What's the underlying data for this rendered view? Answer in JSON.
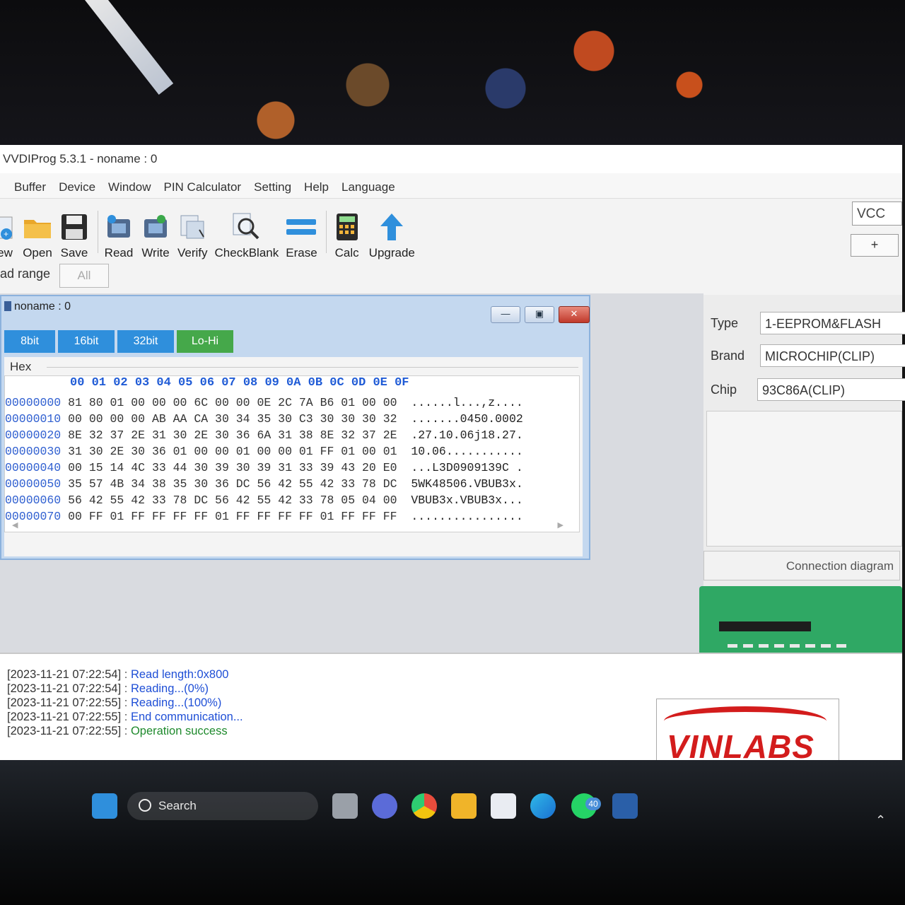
{
  "window": {
    "title": "VVDIProg 5.3.1 - noname : 0"
  },
  "menu": [
    "Buffer",
    "Device",
    "Window",
    "PIN Calculator",
    "Setting",
    "Help",
    "Language"
  ],
  "toolbar": {
    "new": "ew",
    "open": "Open",
    "save": "Save",
    "read": "Read",
    "write": "Write",
    "verify": "Verify",
    "checkblank": "CheckBlank",
    "erase": "Erase",
    "calc": "Calc",
    "upgrade": "Upgrade"
  },
  "vcc": {
    "label": "VCC",
    "plus": "+"
  },
  "range": {
    "label": "ad range",
    "value": "All"
  },
  "buffer_window": {
    "title": "noname : 0",
    "modes": [
      "8bit",
      "16bit",
      "32bit",
      "Lo-Hi"
    ],
    "hex_label": "Hex",
    "header": "00 01 02 03 04 05 06 07 08 09 0A 0B 0C 0D 0E 0F",
    "rows": [
      {
        "addr": "00000000",
        "bytes": "81 80 01 00 00 00 6C 00 00 0E 2C 7A B6 01 00 00",
        "ascii": "......l...,z...."
      },
      {
        "addr": "00000010",
        "bytes": "00 00 00 00 AB AA CA 30 34 35 30 C3 30 30 30 32",
        "ascii": ".......0450.0002"
      },
      {
        "addr": "00000020",
        "bytes": "8E 32 37 2E 31 30 2E 30 36 6A 31 38 8E 32 37 2E",
        "ascii": ".27.10.06j18.27."
      },
      {
        "addr": "00000030",
        "bytes": "31 30 2E 30 36 01 00 00 01 00 00 01 FF 01 00 01",
        "ascii": "10.06..........."
      },
      {
        "addr": "00000040",
        "bytes": "00 15 14 4C 33 44 30 39 30 39 31 33 39 43 20 E0",
        "ascii": "...L3D0909139C ."
      },
      {
        "addr": "00000050",
        "bytes": "35 57 4B 34 38 35 30 36 DC 56 42 55 42 33 78 DC",
        "ascii": "5WK48506.VBUB3x."
      },
      {
        "addr": "00000060",
        "bytes": "56 42 55 42 33 78 DC 56 42 55 42 33 78 05 04 00",
        "ascii": "VBUB3x.VBUB3x..."
      },
      {
        "addr": "00000070",
        "bytes": "00 FF 01 FF FF FF FF 01 FF FF FF FF 01 FF FF FF",
        "ascii": "................"
      }
    ]
  },
  "properties": {
    "type_label": "Type",
    "type_value": "1-EEPROM&FLASH",
    "brand_label": "Brand",
    "brand_value": "MICROCHIP(CLIP)",
    "chip_label": "Chip",
    "chip_value": "93C86A(CLIP)",
    "connection_button": "Connection diagram"
  },
  "log": [
    {
      "ts": "[2023-11-21 07:22:54]",
      "msg": "Read length:0x800",
      "status": "info"
    },
    {
      "ts": "[2023-11-21 07:22:54]",
      "msg": "Reading...(0%)",
      "status": "info"
    },
    {
      "ts": "[2023-11-21 07:22:55]",
      "msg": "Reading...(100%)",
      "status": "info"
    },
    {
      "ts": "[2023-11-21 07:22:55]",
      "msg": "End communication...",
      "status": "info"
    },
    {
      "ts": "[2023-11-21 07:22:55]",
      "msg": "Operation success",
      "status": "ok"
    }
  ],
  "watermark": {
    "text": "VINLABS"
  },
  "taskbar": {
    "search_label": "Search",
    "whatsapp_badge": "40"
  },
  "colors": {
    "mode_blue": "#2f8fdc",
    "mode_green": "#45a84a",
    "hex_blue": "#1f5bd6",
    "log_blue": "#1f4fd6",
    "log_green": "#1f8a2d"
  }
}
